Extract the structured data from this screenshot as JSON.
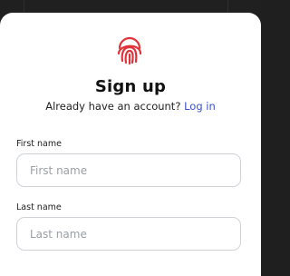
{
  "signup": {
    "title": "Sign up",
    "prompt_text": "Already have an account?",
    "login_link": "Log in",
    "fields": [
      {
        "label": "First name",
        "placeholder": "First name",
        "value": ""
      },
      {
        "label": "Last name",
        "placeholder": "Last name",
        "value": ""
      }
    ]
  },
  "colors": {
    "brand": "#e0343a",
    "link": "#3a4fc7",
    "backdrop": "#202020",
    "card": "#ffffff",
    "input_border": "#cfd3d8"
  },
  "icons": {
    "logo": "fingerprint-icon"
  }
}
